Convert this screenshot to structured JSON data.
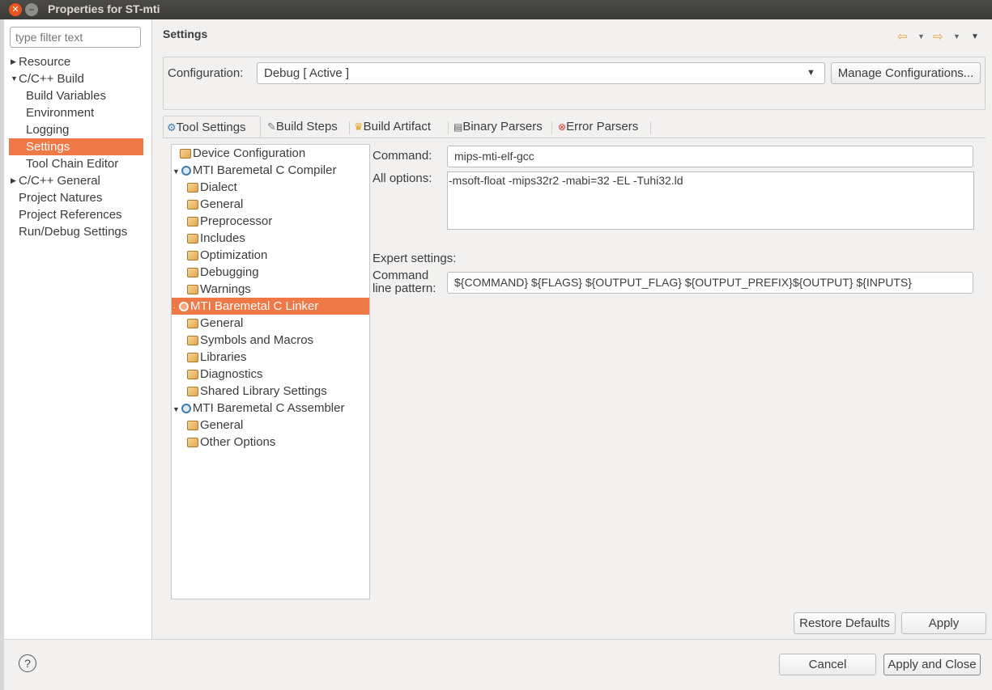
{
  "window": {
    "title": "Properties for ST-mti"
  },
  "filter": {
    "placeholder": "type filter text"
  },
  "sidebar": {
    "items": [
      {
        "label": "Resource",
        "expander": "collapsed"
      },
      {
        "label": "C/C++ Build",
        "expander": "expanded"
      },
      {
        "label": "Build Variables"
      },
      {
        "label": "Environment"
      },
      {
        "label": "Logging"
      },
      {
        "label": "Settings",
        "selected": true
      },
      {
        "label": "Tool Chain Editor"
      },
      {
        "label": "C/C++ General",
        "expander": "collapsed"
      },
      {
        "label": "Project Natures"
      },
      {
        "label": "Project References"
      },
      {
        "label": "Run/Debug Settings"
      }
    ]
  },
  "page": {
    "title": "Settings"
  },
  "config": {
    "label": "Configuration:",
    "value": "Debug  [ Active ]",
    "manage_label": "Manage Configurations..."
  },
  "tabs": [
    {
      "label": "Tool Settings",
      "icon": "tool-settings-icon",
      "active": true
    },
    {
      "label": "Build Steps",
      "icon": "build-steps-icon"
    },
    {
      "label": "Build Artifact",
      "icon": "trophy-icon"
    },
    {
      "label": "Binary Parsers",
      "icon": "binary-icon"
    },
    {
      "label": "Error Parsers",
      "icon": "error-icon"
    }
  ],
  "tree": [
    {
      "label": "Device Configuration",
      "icon": "folder-icon"
    },
    {
      "label": "MTI Baremetal C Compiler",
      "icon": "gear-icon",
      "expander": "expanded"
    },
    {
      "label": "Dialect",
      "icon": "folder-icon"
    },
    {
      "label": "General",
      "icon": "folder-icon"
    },
    {
      "label": "Preprocessor",
      "icon": "folder-icon"
    },
    {
      "label": "Includes",
      "icon": "folder-icon"
    },
    {
      "label": "Optimization",
      "icon": "folder-icon"
    },
    {
      "label": "Debugging",
      "icon": "folder-icon"
    },
    {
      "label": "Warnings",
      "icon": "folder-icon"
    },
    {
      "label": "MTI Baremetal C Linker",
      "icon": "gear-icon",
      "expander": "expanded",
      "selected": true
    },
    {
      "label": "General",
      "icon": "folder-icon"
    },
    {
      "label": "Symbols and Macros",
      "icon": "folder-icon"
    },
    {
      "label": "Libraries",
      "icon": "folder-icon"
    },
    {
      "label": "Diagnostics",
      "icon": "folder-icon"
    },
    {
      "label": "Shared Library Settings",
      "icon": "folder-icon"
    },
    {
      "label": "MTI Baremetal C Assembler",
      "icon": "gear-icon",
      "expander": "expanded"
    },
    {
      "label": "General",
      "icon": "folder-icon"
    },
    {
      "label": "Other Options",
      "icon": "folder-icon"
    }
  ],
  "fields": {
    "command_label": "Command:",
    "command_value": "mips-mti-elf-gcc",
    "alloptions_label": "All options:",
    "alloptions_value": "-msoft-float -mips32r2 -mabi=32 -EL -Tuhi32.ld",
    "expert_label": "Expert settings:",
    "pattern_label_1": "Command",
    "pattern_label_2": "line pattern:",
    "pattern_value": "${COMMAND} ${FLAGS} ${OUTPUT_FLAG} ${OUTPUT_PREFIX}${OUTPUT} ${INPUTS}"
  },
  "buttons": {
    "restore": "Restore Defaults",
    "apply": "Apply",
    "cancel": "Cancel",
    "apply_close": "Apply and Close",
    "help": "?"
  },
  "colors": {
    "selection": "#f07746",
    "titlebar": "#3c3b37",
    "close": "#e95420"
  }
}
